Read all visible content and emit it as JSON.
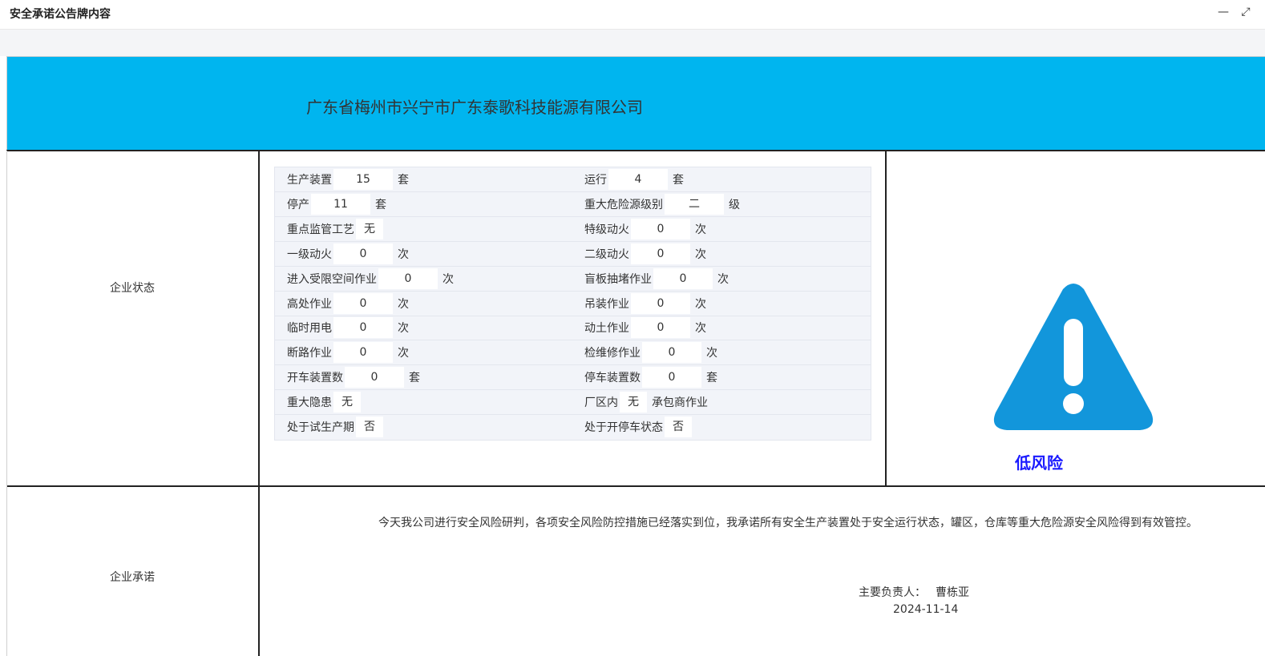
{
  "window": {
    "title": "安全承诺公告牌内容",
    "minimize_label": "—",
    "maximize_label": "⤢"
  },
  "banner": {
    "company": "广东省梅州市兴宁市广东泰歌科技能源有限公司"
  },
  "sections": {
    "status_label": "企业状态",
    "pledge_label": "企业承诺"
  },
  "status": {
    "rows": [
      [
        {
          "label": "生产装置",
          "value": "15",
          "unit": "套"
        },
        {
          "label": "运行",
          "value": "4",
          "unit": "套"
        }
      ],
      [
        {
          "label": "停产",
          "value": "11",
          "unit": "套"
        },
        {
          "label": "重大危险源级别",
          "value": "二",
          "unit": "级"
        }
      ],
      [
        {
          "label": "重点监管工艺",
          "value": "无",
          "unit": ""
        },
        {
          "label": "特级动火",
          "value": "0",
          "unit": "次"
        }
      ],
      [
        {
          "label": "一级动火",
          "value": "0",
          "unit": "次"
        },
        {
          "label": "二级动火",
          "value": "0",
          "unit": "次"
        }
      ],
      [
        {
          "label": "进入受限空间作业",
          "value": "0",
          "unit": "次"
        },
        {
          "label": "盲板抽堵作业",
          "value": "0",
          "unit": "次"
        }
      ],
      [
        {
          "label": "高处作业",
          "value": "0",
          "unit": "次"
        },
        {
          "label": "吊装作业",
          "value": "0",
          "unit": "次"
        }
      ],
      [
        {
          "label": "临时用电",
          "value": "0",
          "unit": "次"
        },
        {
          "label": "动土作业",
          "value": "0",
          "unit": "次"
        }
      ],
      [
        {
          "label": "断路作业",
          "value": "0",
          "unit": "次"
        },
        {
          "label": "检维修作业",
          "value": "0",
          "unit": "次"
        }
      ],
      [
        {
          "label": "开车装置数",
          "value": "0",
          "unit": "套"
        },
        {
          "label": "停车装置数",
          "value": "0",
          "unit": "套"
        }
      ],
      [
        {
          "label": "重大隐患",
          "value": "无",
          "unit": ""
        },
        {
          "label": "厂区内",
          "value": "无",
          "unit": "承包商作业"
        }
      ],
      [
        {
          "label": "处于试生产期",
          "value": "否",
          "unit": ""
        },
        {
          "label": "处于开停车状态",
          "value": "否",
          "unit": ""
        }
      ]
    ]
  },
  "risk": {
    "icon": "warning-triangle-icon",
    "icon_color": "#1296db",
    "level_text": "低风险",
    "level_color": "#1a1aff"
  },
  "pledge": {
    "text": "今天我公司进行安全风险研判，各项安全风险防控措施已经落实到位，我承诺所有安全生产装置处于安全运行状态，罐区，仓库等重大危险源安全风险得到有效管控。",
    "signer_label": "主要负责人：",
    "signer_name": "曹栋亚",
    "date": "2024-11-14"
  },
  "colors": {
    "banner": "#00b5ef",
    "grid_bg": "#f2f4f9"
  }
}
